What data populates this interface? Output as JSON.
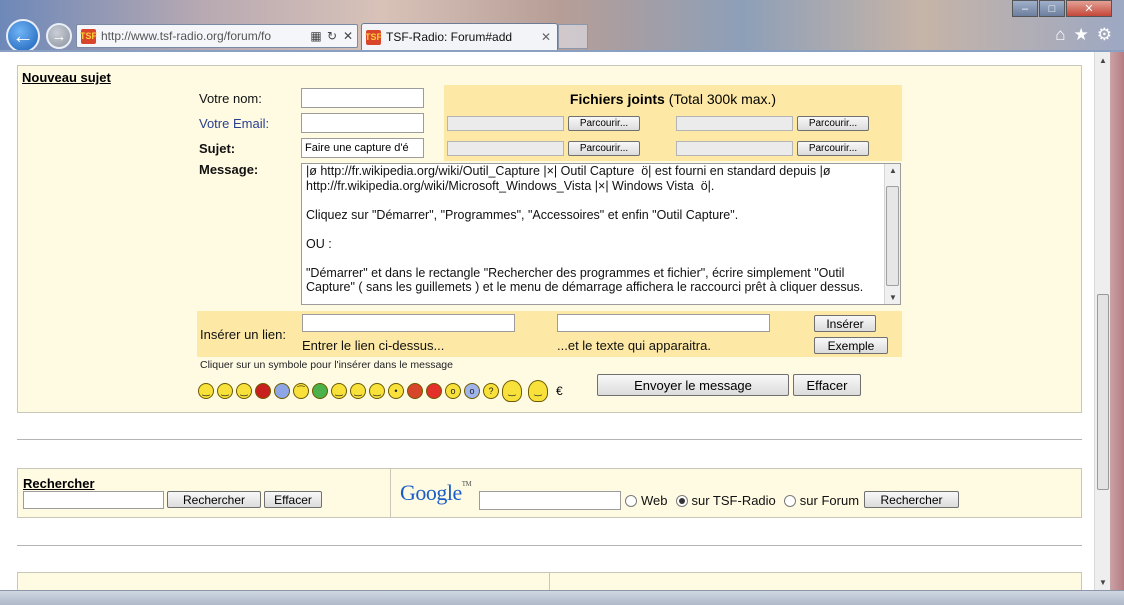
{
  "browser": {
    "address": "http://www.tsf-radio.org/forum/fo",
    "favicon_text": "TSF",
    "tab_title": "TSF-Radio: Forum#add",
    "tab_close": "✕"
  },
  "form": {
    "title": "Nouveau sujet",
    "name_label": "Votre nom:",
    "email_label": "Votre Email:",
    "subject_label": "Sujet:",
    "subject_value": "Faire une capture d'é",
    "message_label": "Message:",
    "message_value": "|ø http://fr.wikipedia.org/wiki/Outil_Capture |×| Outil Capture  ö| est fourni en standard depuis |ø http://fr.wikipedia.org/wiki/Microsoft_Windows_Vista |×| Windows Vista  ö|.\n\nCliquez sur \"Démarrer\", \"Programmes\", \"Accessoires\" et enfin \"Outil Capture\".\n\nOU :\n\n\"Démarrer\" et dans le rectangle \"Rechercher des programmes et fichier\", écrire simplement \"Outil Capture\" ( sans les guillemets ) et le menu de démarrage affichera le raccourci prêt à cliquer dessus.",
    "attachments": {
      "title_bold": "Fichiers joints",
      "title_rest": " (Total 300k max.)",
      "browse_label": "Parcourir..."
    },
    "link": {
      "label": "Insérer un lien:",
      "url_hint": "Entrer le lien ci-dessus...",
      "text_hint": "...et le texte qui apparaitra.",
      "insert_button": "Insérer",
      "example_button": "Exemple"
    },
    "symbol_hint": "Cliquer sur un symbole pour l'insérer dans le message",
    "euro_symbol": "€",
    "send_button": "Envoyer le message",
    "clear_button": "Effacer"
  },
  "search": {
    "title": "Rechercher",
    "search_button": "Rechercher",
    "clear_button": "Effacer",
    "google_logo": "Google",
    "google_tm": "TM",
    "radio_web": "Web",
    "radio_site": "sur TSF-Radio",
    "radio_forum": "sur Forum",
    "google_search_button": "Rechercher",
    "selected_scope": "sur TSF-Radio"
  },
  "colors": {
    "panel_bg": "#fffbe3",
    "highlight_bg": "#fde9a5",
    "email_label": "#2a3e8f"
  }
}
